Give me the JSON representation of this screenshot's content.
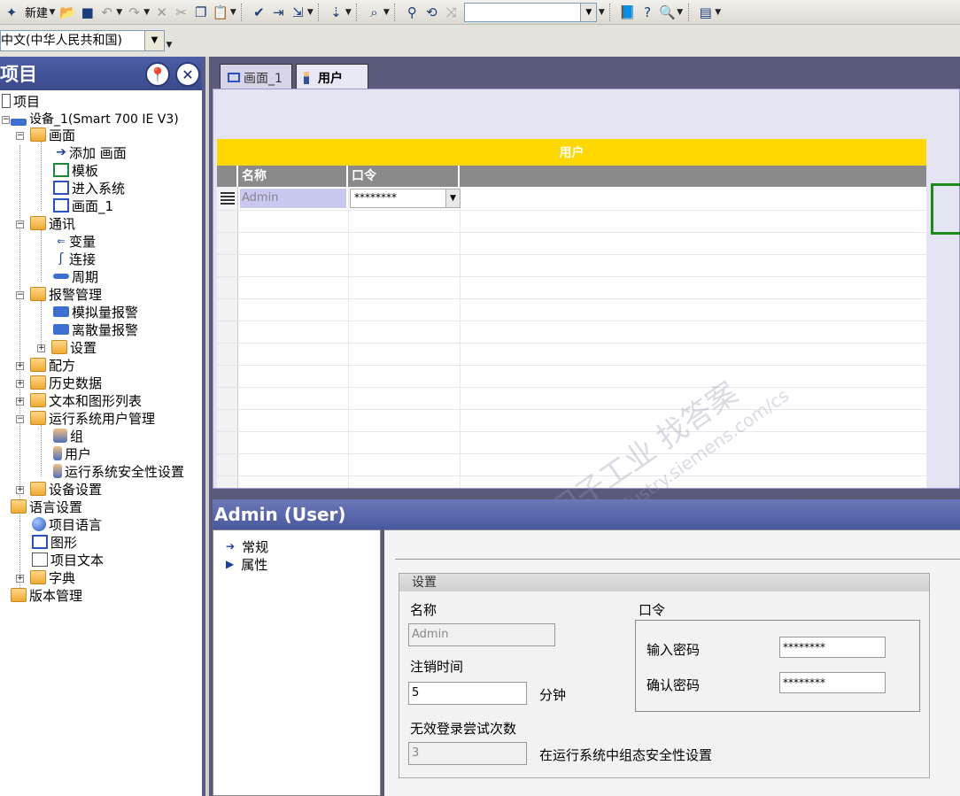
{
  "toolbar": {
    "new_label": "新建",
    "language_select": "中文(中华人民共和国)"
  },
  "project_panel": {
    "title": "项目",
    "tree": [
      {
        "label": "项目"
      },
      {
        "label": "设备_1(Smart 700 IE V3)"
      },
      {
        "label": "画面"
      },
      {
        "label": "添加 画面"
      },
      {
        "label": "模板"
      },
      {
        "label": "进入系统"
      },
      {
        "label": "画面_1"
      },
      {
        "label": "通讯"
      },
      {
        "label": "变量"
      },
      {
        "label": "连接"
      },
      {
        "label": "周期"
      },
      {
        "label": "报警管理"
      },
      {
        "label": "模拟量报警"
      },
      {
        "label": "离散量报警"
      },
      {
        "label": "设置"
      },
      {
        "label": "配方"
      },
      {
        "label": "历史数据"
      },
      {
        "label": "文本和图形列表"
      },
      {
        "label": "运行系统用户管理"
      },
      {
        "label": "组"
      },
      {
        "label": "用户"
      },
      {
        "label": "运行系统安全性设置"
      },
      {
        "label": "设备设置"
      },
      {
        "label": "语言设置"
      },
      {
        "label": "项目语言"
      },
      {
        "label": "图形"
      },
      {
        "label": "项目文本"
      },
      {
        "label": "字典"
      },
      {
        "label": "版本管理"
      }
    ]
  },
  "tabs": [
    {
      "label": "画面_1"
    },
    {
      "label": "用户"
    }
  ],
  "user_table": {
    "title": "用户",
    "columns": [
      "名称",
      "口令"
    ],
    "rows": [
      {
        "name": "Admin",
        "password": "********"
      }
    ]
  },
  "watermark": {
    "line1": "西门子工业  找答案",
    "line2": "support.industry.siemens.com/cs"
  },
  "properties": {
    "header": "Admin (User)",
    "nav": [
      "常规",
      "属性"
    ],
    "group_title": "设置",
    "name_label": "名称",
    "name_value": "Admin",
    "logoff_label": "注销时间",
    "logoff_value": "5",
    "logoff_unit": "分钟",
    "attempts_label": "无效登录尝试次数",
    "attempts_value": "3",
    "attempts_note": "在运行系统中组态安全性设置",
    "password_label": "口令",
    "enter_password_label": "输入密码",
    "enter_password_value": "********",
    "confirm_password_label": "确认密码",
    "confirm_password_value": "********"
  }
}
